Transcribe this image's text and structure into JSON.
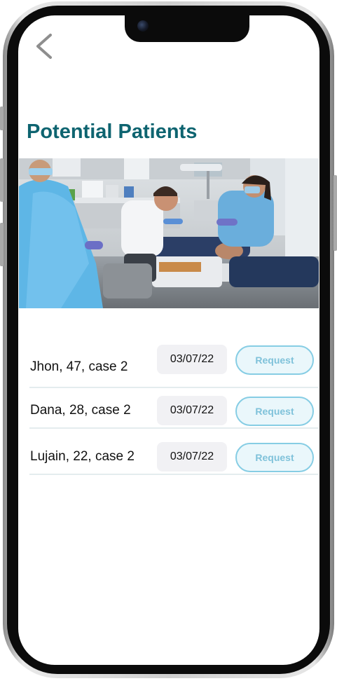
{
  "page": {
    "title": "Potential Patients",
    "accent_color": "#0e6470"
  },
  "nav": {
    "back_icon": "chevron-left-icon"
  },
  "hero_image": {
    "subject": "dental clinic photo"
  },
  "patients": [
    {
      "label": "Jhon, 47, case 2",
      "date": "03/07/22",
      "action": "Request"
    },
    {
      "label": "Dana, 28, case 2",
      "date": "03/07/22",
      "action": "Request"
    },
    {
      "label": "Lujain, 22, case 2",
      "date": "03/07/22",
      "action": "Request"
    }
  ],
  "colors": {
    "request_border": "#86cde4",
    "request_text": "#7fc2da",
    "date_bg": "#f1f1f4"
  }
}
